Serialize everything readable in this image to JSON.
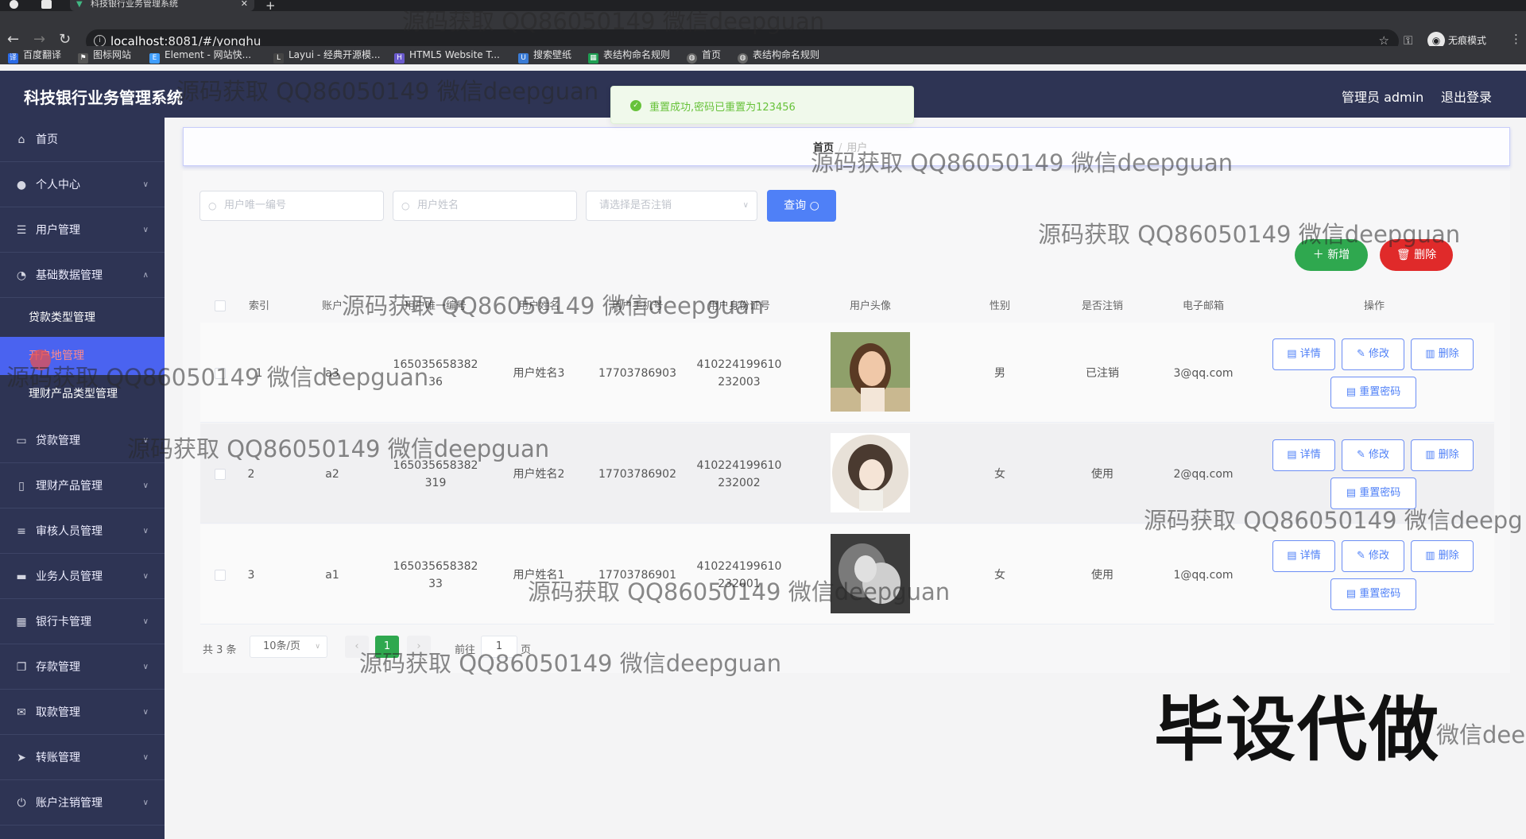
{
  "browser": {
    "tab_title": "科技银行业务管理系统",
    "url_host": "localhost",
    "url_rest": ":8081/#/yonghu",
    "profile_label": "无痕模式",
    "bookmarks": [
      "百度翻译",
      "图标网站",
      "Element - 网站快...",
      "Layui - 经典开源模...",
      "HTML5 Website T...",
      "搜索壁纸",
      "表结构命名规则",
      "首页",
      "表结构命名规则"
    ]
  },
  "header": {
    "title": "科技银行业务管理系统",
    "admin_label": "管理员 admin",
    "logout_label": "退出登录"
  },
  "sidebar": {
    "items": [
      {
        "label": "首页",
        "icon": "home-icon"
      },
      {
        "label": "个人中心",
        "icon": "user-icon"
      },
      {
        "label": "用户管理",
        "icon": "sliders-icon"
      },
      {
        "label": "基础数据管理",
        "icon": "gauge-icon"
      },
      {
        "label": "贷款管理",
        "icon": "card-icon"
      },
      {
        "label": "理财产品管理",
        "icon": "phone-icon"
      },
      {
        "label": "审核人员管理",
        "icon": "list-icon"
      },
      {
        "label": "业务人员管理",
        "icon": "monitor-icon"
      },
      {
        "label": "银行卡管理",
        "icon": "grid-icon"
      },
      {
        "label": "存款管理",
        "icon": "copy-icon"
      },
      {
        "label": "取款管理",
        "icon": "mail-icon"
      },
      {
        "label": "转账管理",
        "icon": "send-icon"
      },
      {
        "label": "账户注销管理",
        "icon": "power-icon"
      }
    ],
    "sub_items": [
      "贷款类型管理",
      "开户地管理",
      "理财产品类型管理"
    ]
  },
  "breadcrumb": {
    "home": "首页",
    "current": "用户"
  },
  "search": {
    "uid_placeholder": "用户唯一编号",
    "name_placeholder": "用户姓名",
    "status_placeholder": "请选择是否注销",
    "query_label": "查询"
  },
  "actions": {
    "add_label": "新增",
    "delete_label": "删除"
  },
  "table": {
    "columns": [
      "索引",
      "账户",
      "用户唯一编号",
      "用户姓名",
      "用户手机号",
      "用户身份证号",
      "用户头像",
      "性别",
      "是否注销",
      "电子邮箱",
      "操作"
    ],
    "rows": [
      {
        "index": "1",
        "account": "a3",
        "uid_line1": "165035658382",
        "uid_line2": "36",
        "name": "用户姓名3",
        "phone": "17703786903",
        "idcard_line1": "410224199610",
        "idcard_line2": "232003",
        "gender": "男",
        "status": "已注销",
        "email": "3@qq.com"
      },
      {
        "index": "2",
        "account": "a2",
        "uid_line1": "165035658382",
        "uid_line2": "319",
        "name": "用户姓名2",
        "phone": "17703786902",
        "idcard_line1": "410224199610",
        "idcard_line2": "232002",
        "gender": "女",
        "status": "使用",
        "email": "2@qq.com"
      },
      {
        "index": "3",
        "account": "a1",
        "uid_line1": "165035658382",
        "uid_line2": "33",
        "name": "用户姓名1",
        "phone": "17703786901",
        "idcard_line1": "410224199610",
        "idcard_line2": "232001",
        "gender": "女",
        "status": "使用",
        "email": "1@qq.com"
      }
    ],
    "op_labels": {
      "detail": "详情",
      "edit": "修改",
      "delete": "删除",
      "reset": "重置密码"
    }
  },
  "pagination": {
    "total_label": "共 3 条",
    "page_size": "10条/页",
    "current_page": "1",
    "goto_label": "前往",
    "goto_value": "1",
    "page_suffix": "页"
  },
  "toast": {
    "message": "重置成功,密码已重置为123456"
  },
  "watermarks": {
    "text": "源码获取 QQ86050149 微信deepguan",
    "text_cut": "源码获取 QQ86050149 微信deepg",
    "promo": "毕设代做",
    "partial_text": "微信dee"
  },
  "colors": {
    "sidebar": "#2e3454",
    "primary": "#4f80f7",
    "success": "#2fa84f",
    "danger": "#e02a2a"
  }
}
